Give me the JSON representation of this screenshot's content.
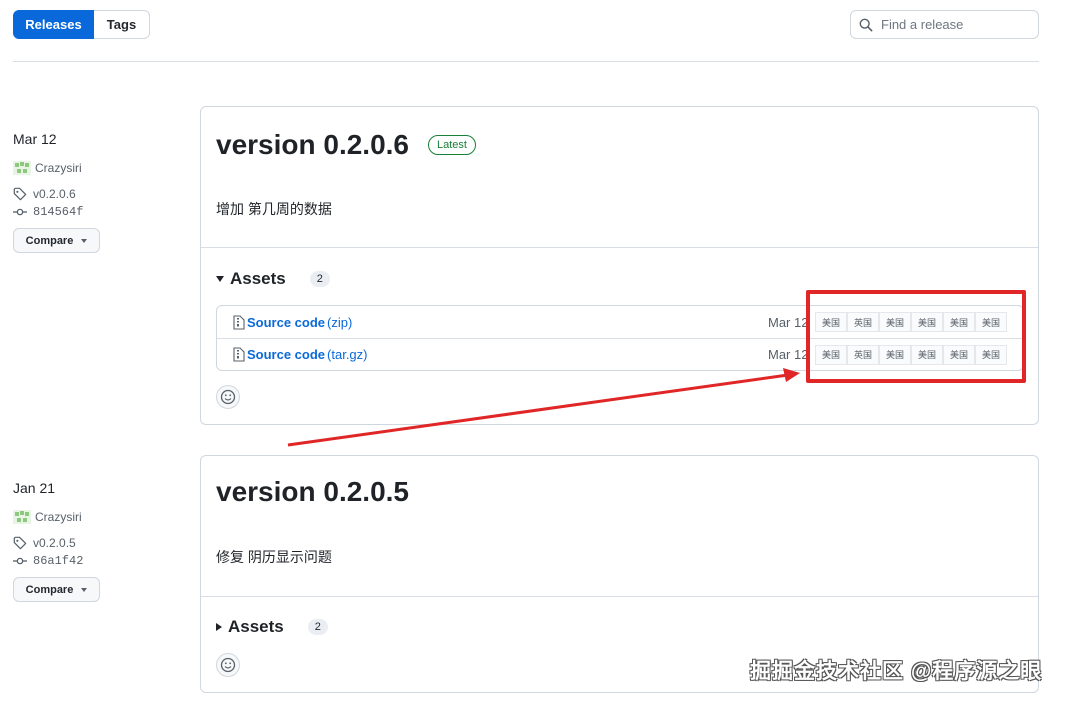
{
  "tabs": [
    {
      "label": "Releases",
      "active": true
    },
    {
      "label": "Tags",
      "active": false
    }
  ],
  "search": {
    "placeholder": "Find a release",
    "value": ""
  },
  "releases": [
    {
      "date": "Mar 12",
      "author": "Crazysiri",
      "tag": "v0.2.0.6",
      "commit": "814564f",
      "compare_label": "Compare",
      "title": "version 0.2.0.6",
      "badge": "Latest",
      "body": "增加 第几周的数据",
      "assets_label": "Assets",
      "assets_count": "2",
      "assets_expanded": true,
      "assets": [
        {
          "icon": "file-zip-icon",
          "name_bold": "Source code",
          "name_suffix": " (zip)",
          "date": "Mar 12",
          "chips": [
            "美国",
            "英国",
            "美国",
            "美国",
            "美国",
            "美国"
          ]
        },
        {
          "icon": "file-zip-icon",
          "name_bold": "Source code",
          "name_suffix": " (tar.gz)",
          "date": "Mar 12",
          "chips": [
            "美国",
            "英国",
            "美国",
            "美国",
            "美国",
            "美国"
          ]
        }
      ]
    },
    {
      "date": "Jan 21",
      "author": "Crazysiri",
      "tag": "v0.2.0.5",
      "commit": "86a1f42",
      "compare_label": "Compare",
      "title": "version 0.2.0.5",
      "body": "修复 阴历显示问题",
      "assets_label": "Assets",
      "assets_count": "2",
      "assets_expanded": false
    }
  ],
  "annotation": {
    "color": "#e02626"
  },
  "colors": {
    "accent": "#0969da",
    "latest": "#1a7f37",
    "border": "#d0d7de"
  },
  "watermark": "掘掘金技术社区 @程序源之眼"
}
